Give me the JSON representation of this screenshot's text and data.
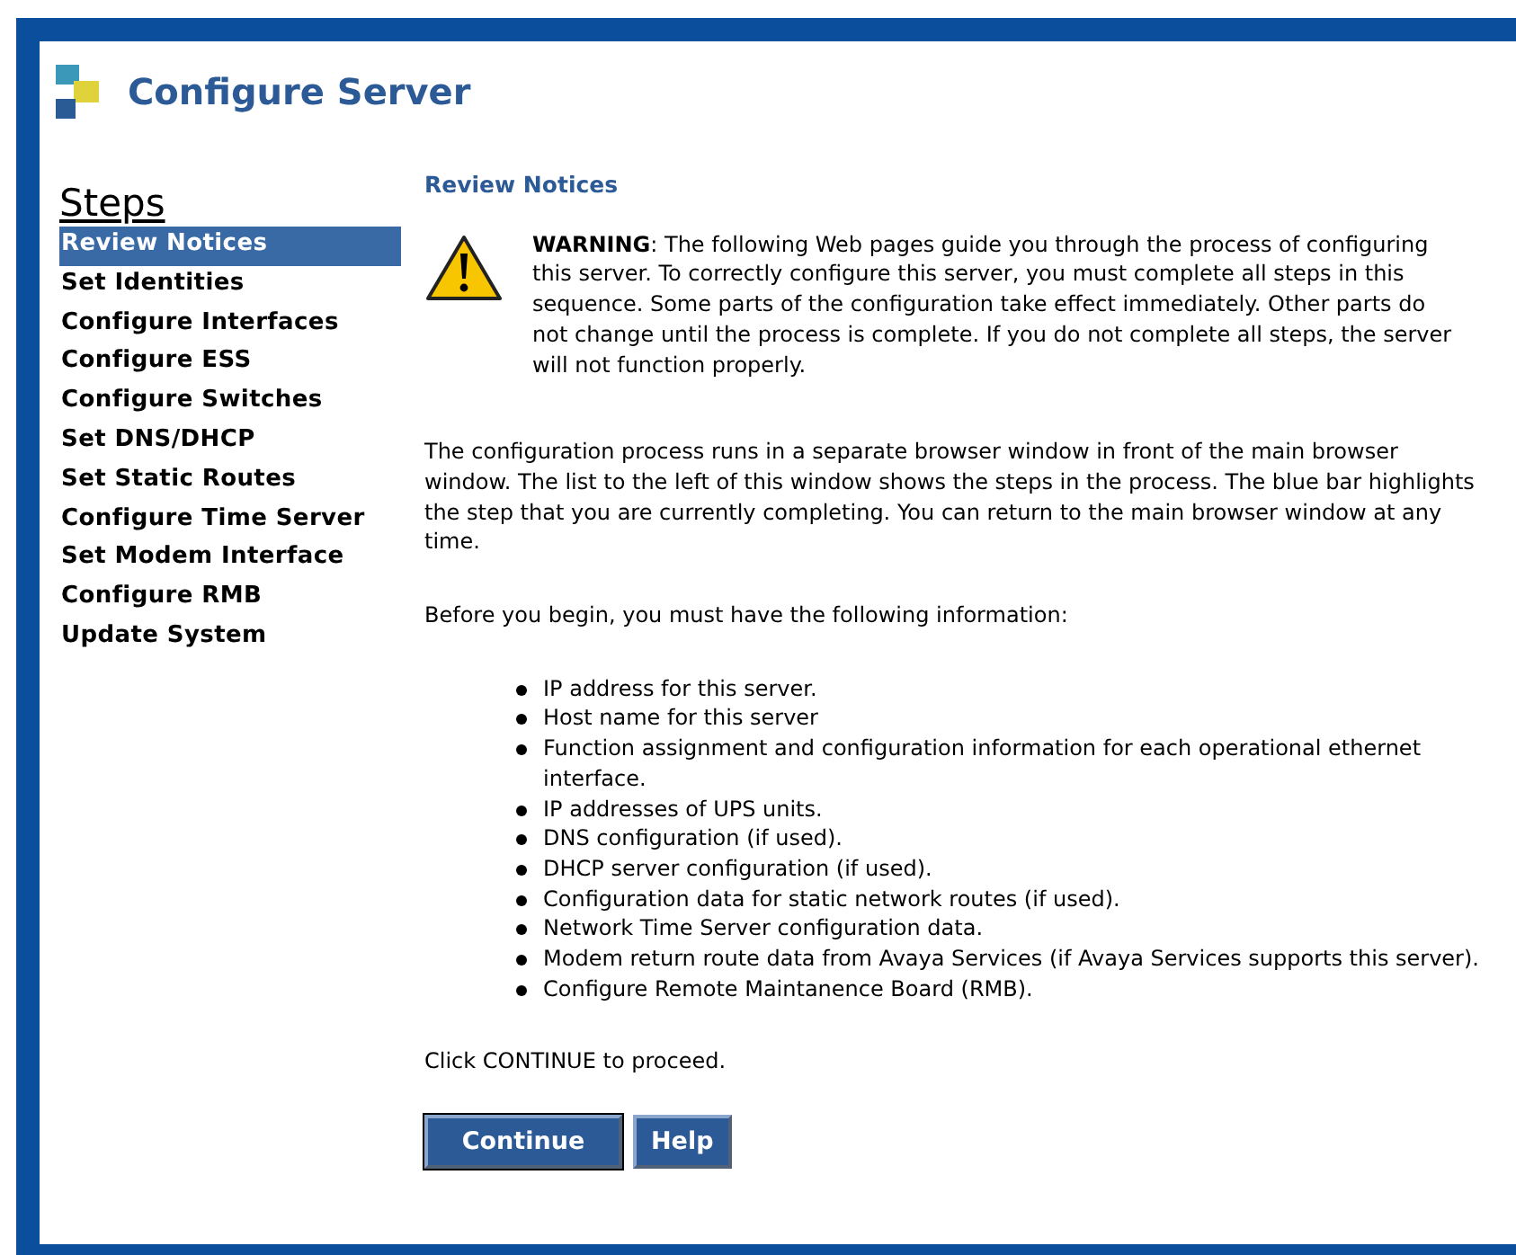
{
  "header": {
    "title": "Configure Server"
  },
  "sidebar": {
    "heading": "Steps",
    "items": [
      {
        "label": "Review Notices",
        "selected": true
      },
      {
        "label": "Set Identities",
        "selected": false
      },
      {
        "label": "Configure Interfaces",
        "selected": false
      },
      {
        "label": "Configure ESS",
        "selected": false
      },
      {
        "label": "Configure Switches",
        "selected": false
      },
      {
        "label": "Set DNS/DHCP",
        "selected": false
      },
      {
        "label": "Set Static Routes",
        "selected": false
      },
      {
        "label": "Configure Time Server",
        "selected": false
      },
      {
        "label": "Set Modem Interface",
        "selected": false
      },
      {
        "label": "Configure RMB",
        "selected": false
      },
      {
        "label": "Update System",
        "selected": false
      }
    ]
  },
  "content": {
    "heading": "Review Notices",
    "warning": "**WARNING**: The following Web pages guide you through the process of configuring this server. To correctly configure this server, you must complete all steps in this sequence. Some parts of the configuration take effect immediately. Other parts do not change until the process is complete. If you do not complete all steps, the server will not function properly.",
    "intro": "The configuration process runs in a separate browser window in front of the main browser window. The list to the left of this window shows the steps in the process. The blue bar highlights the step that you are currently completing. You can return to the main browser window at any time.",
    "before": "Before you begin, you must have the following information:",
    "requirements": [
      "IP address for this server.",
      "Host name for this server",
      "Function assignment and configuration information for each operational ethernet interface.",
      "IP addresses of UPS units.",
      "DNS configuration (if used).",
      "DHCP server configuration (if used).",
      "Configuration data for static network routes (if used).",
      "Network Time Server configuration data.",
      "Modem return route data from Avaya Services (if Avaya Services supports this server).",
      "Configure Remote Maintanence Board (RMB)."
    ],
    "proceed": "Click CONTINUE to proceed.",
    "buttons": [
      {
        "label": "Continue",
        "kind": "default"
      },
      {
        "label": "Help",
        "kind": "normal"
      }
    ]
  }
}
